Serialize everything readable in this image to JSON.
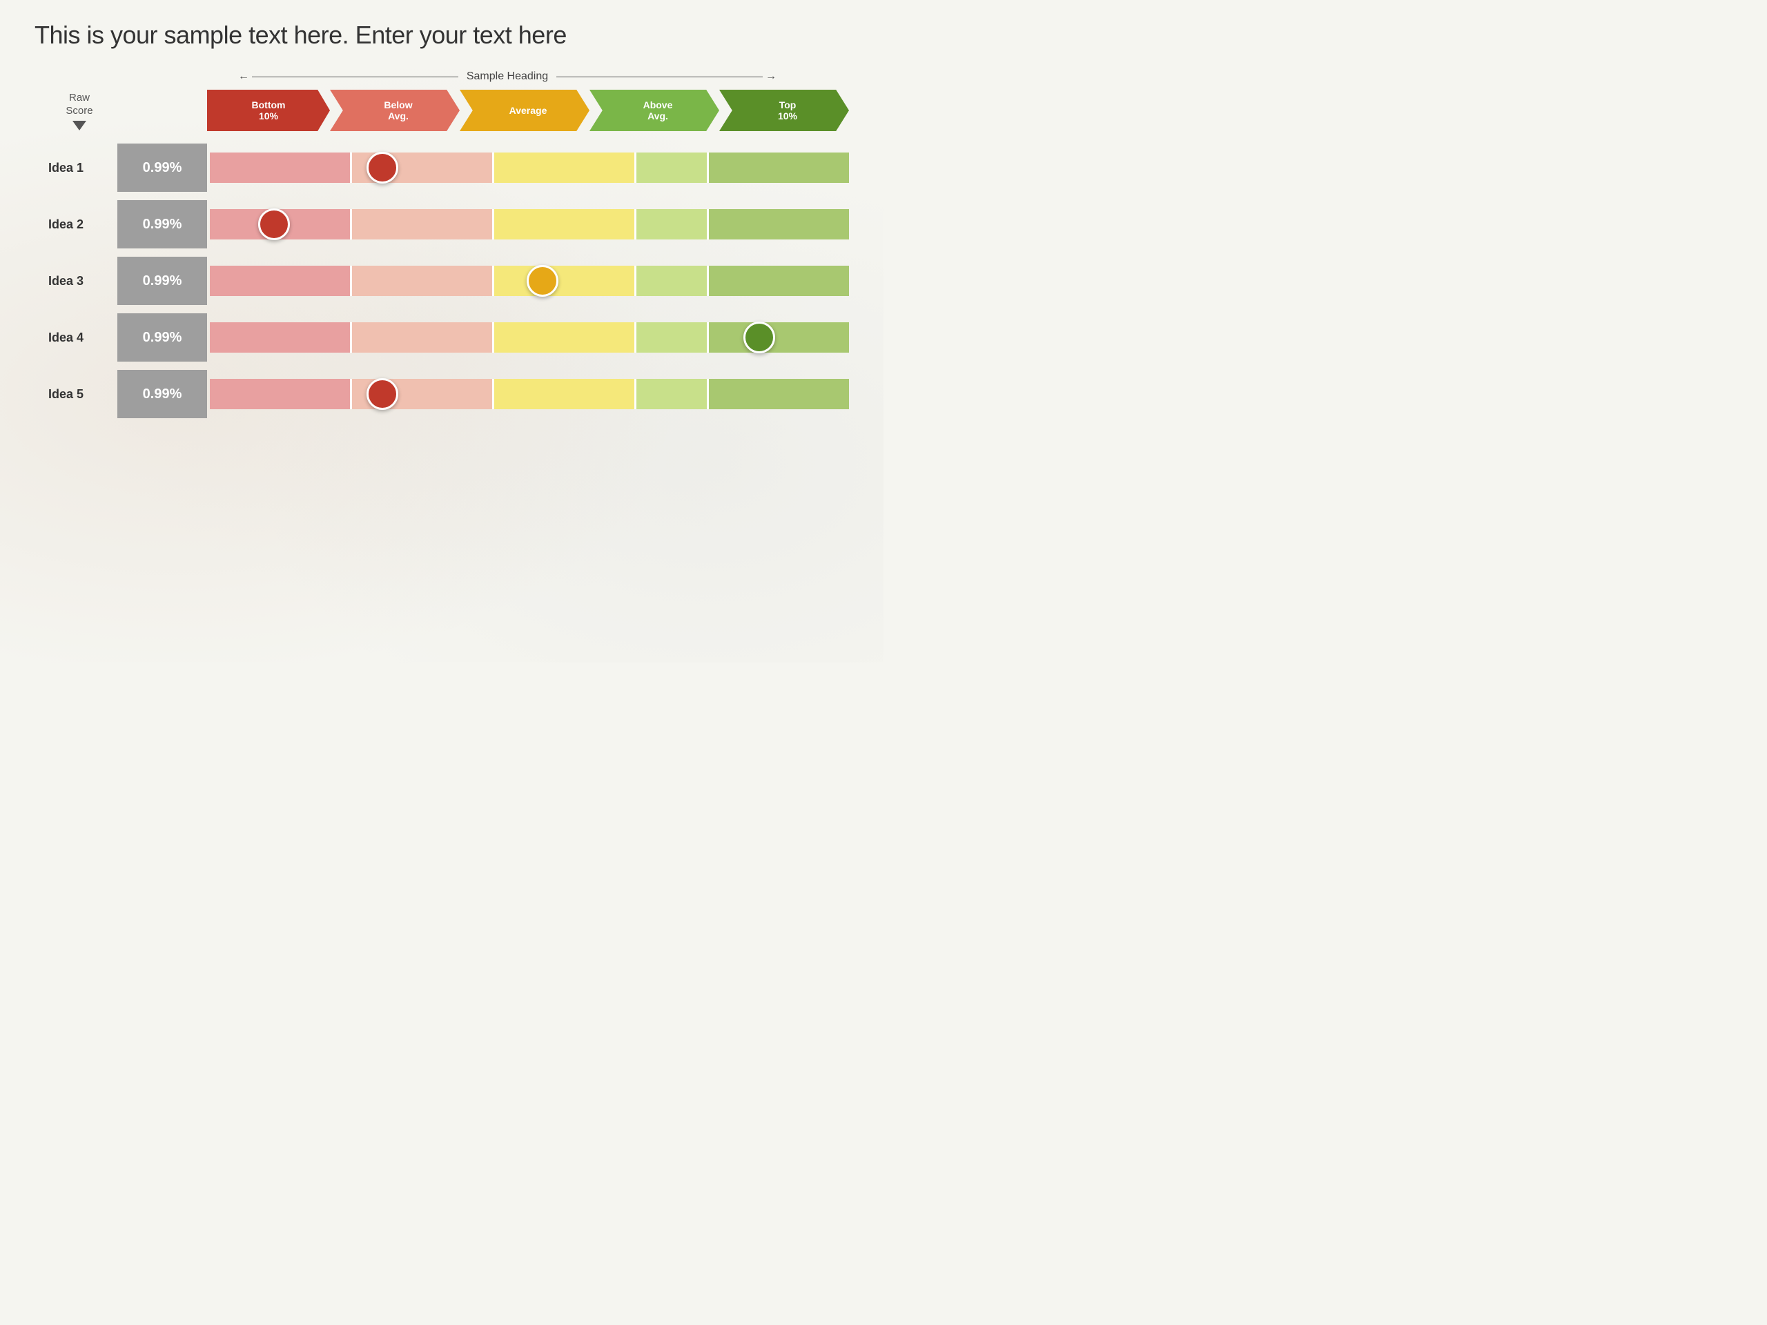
{
  "title": "This is your sample text here. Enter your text here",
  "heading": {
    "label": "Sample Heading"
  },
  "rawScore": {
    "line1": "Raw",
    "line2": "Score"
  },
  "chevrons": [
    {
      "id": "c1",
      "label": "Bottom\n10%",
      "colorClass": "c1"
    },
    {
      "id": "c2",
      "label": "Below\nAvg.",
      "colorClass": "c2"
    },
    {
      "id": "c3",
      "label": "Average",
      "colorClass": "c3"
    },
    {
      "id": "c4",
      "label": "Above\nAvg.",
      "colorClass": "c4"
    },
    {
      "id": "c5",
      "label": "Top\n10%",
      "colorClass": "c5"
    }
  ],
  "rows": [
    {
      "id": "idea1",
      "label": "Idea 1",
      "score": "0.99%",
      "markerColor": "red",
      "markerPositionPct": 27
    },
    {
      "id": "idea2",
      "label": "Idea 2",
      "score": "0.99%",
      "markerColor": "red",
      "markerPositionPct": 10
    },
    {
      "id": "idea3",
      "label": "Idea 3",
      "score": "0.99%",
      "markerColor": "orange",
      "markerPositionPct": 52
    },
    {
      "id": "idea4",
      "label": "Idea 4",
      "score": "0.99%",
      "markerColor": "green",
      "markerPositionPct": 86
    },
    {
      "id": "idea5",
      "label": "Idea 5",
      "score": "0.99%",
      "markerColor": "red",
      "markerPositionPct": 27
    }
  ]
}
